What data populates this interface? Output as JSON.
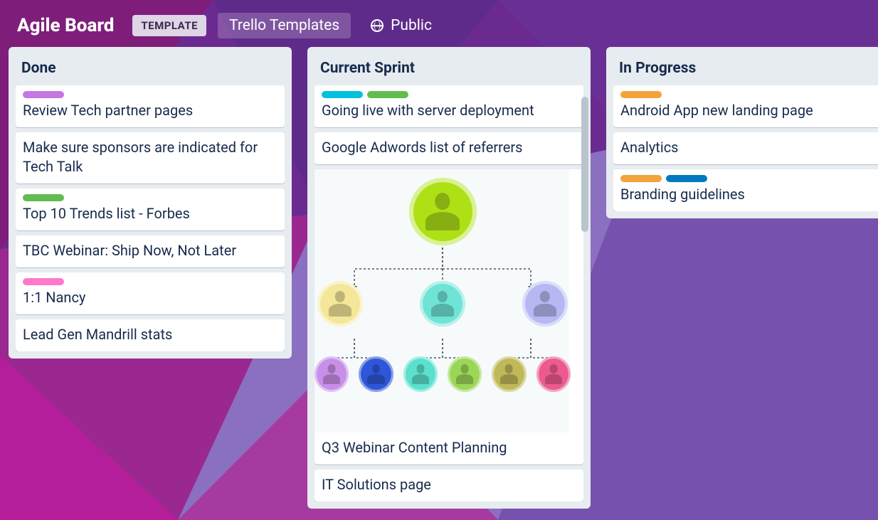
{
  "header": {
    "title": "Agile Board",
    "template_badge": "TEMPLATE",
    "templates_link": "Trello Templates",
    "public_label": "Public"
  },
  "label_colors": {
    "purple": "#c377e0",
    "cyan": "#00c2e0",
    "green": "#61bd4f",
    "orange": "#f2a33a",
    "blue": "#0079bf",
    "pink": "#ff78cb"
  },
  "lists": [
    {
      "title": "Done",
      "cards": [
        {
          "labels": [
            "purple"
          ],
          "text": "Review Tech partner pages"
        },
        {
          "labels": [],
          "text": "Make sure sponsors are indicated for Tech Talk"
        },
        {
          "labels": [
            "green"
          ],
          "text": "Top 10 Trends list - Forbes"
        },
        {
          "labels": [],
          "text": "TBC Webinar: Ship Now, Not Later"
        },
        {
          "labels": [
            "pink"
          ],
          "text": "1:1 Nancy"
        },
        {
          "labels": [],
          "text": "Lead Gen Mandrill stats"
        }
      ]
    },
    {
      "title": "Current Sprint",
      "has_scroll": true,
      "cards": [
        {
          "labels": [
            "cyan",
            "green"
          ],
          "text": "Going live with server deployment"
        },
        {
          "labels": [],
          "text": "Google Adwords list of referrers"
        },
        {
          "labels": [],
          "text": "Q3 Webinar Content Planning",
          "has_image": true
        },
        {
          "labels": [],
          "text": "IT Solutions page"
        }
      ]
    },
    {
      "title": "In Progress",
      "cards": [
        {
          "labels": [
            "orange"
          ],
          "text": "Android App new landing page"
        },
        {
          "labels": [],
          "text": "Analytics"
        },
        {
          "labels": [
            "orange",
            "blue"
          ],
          "text": "Branding guidelines"
        }
      ]
    }
  ],
  "org_chart_colors": {
    "top": "#aee016",
    "mid": [
      "#f4e79a",
      "#6fe3d6",
      "#b6b8f2"
    ],
    "bottom": [
      "#c88fe8",
      "#2f56d6",
      "#5ce0ce",
      "#9bd658",
      "#c0b95a",
      "#ec5a90"
    ]
  }
}
